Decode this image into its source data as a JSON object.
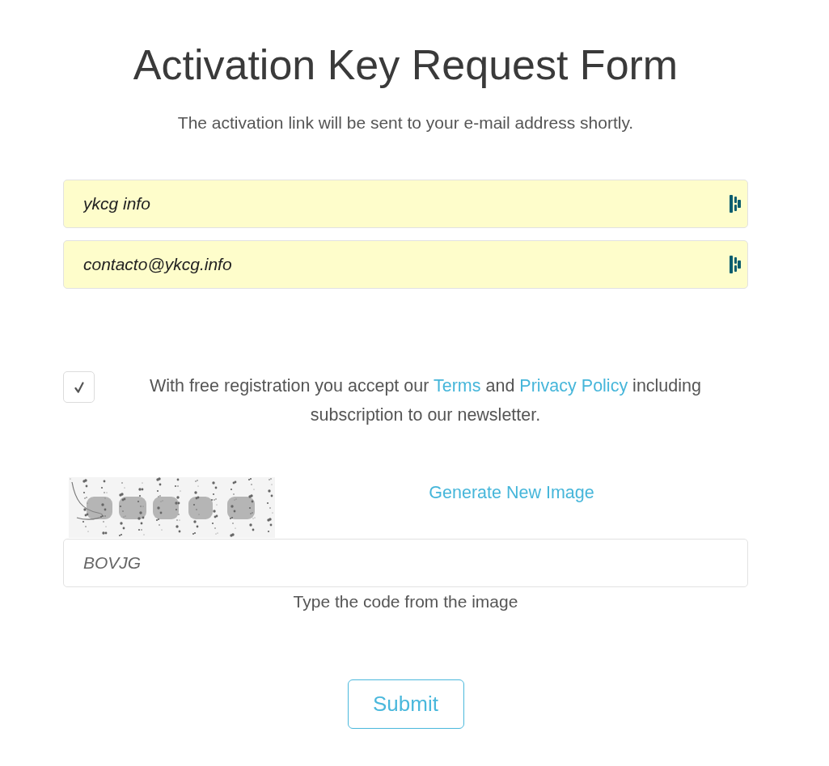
{
  "header": {
    "title": "Activation Key Request Form",
    "subtitle": "The activation link will be sent to your e-mail address shortly."
  },
  "fields": [
    {
      "value": "ykcg info",
      "autofilled": true
    },
    {
      "value": "contacto@ykcg.info",
      "autofilled": true
    }
  ],
  "consent": {
    "checked": true,
    "segments": [
      {
        "kind": "text",
        "text": "With free registration you accept our "
      },
      {
        "kind": "link",
        "text": "Terms"
      },
      {
        "kind": "text",
        "text": " and "
      },
      {
        "kind": "link",
        "text": "Privacy Policy"
      },
      {
        "kind": "text",
        "text": " including subscription to our newsletter."
      }
    ]
  },
  "captcha": {
    "link": "Generate New Image",
    "field": {
      "value": "BOVJG",
      "autofilled": false
    },
    "hint": "Type the code from the image"
  },
  "submit": {
    "label": "Submit"
  }
}
